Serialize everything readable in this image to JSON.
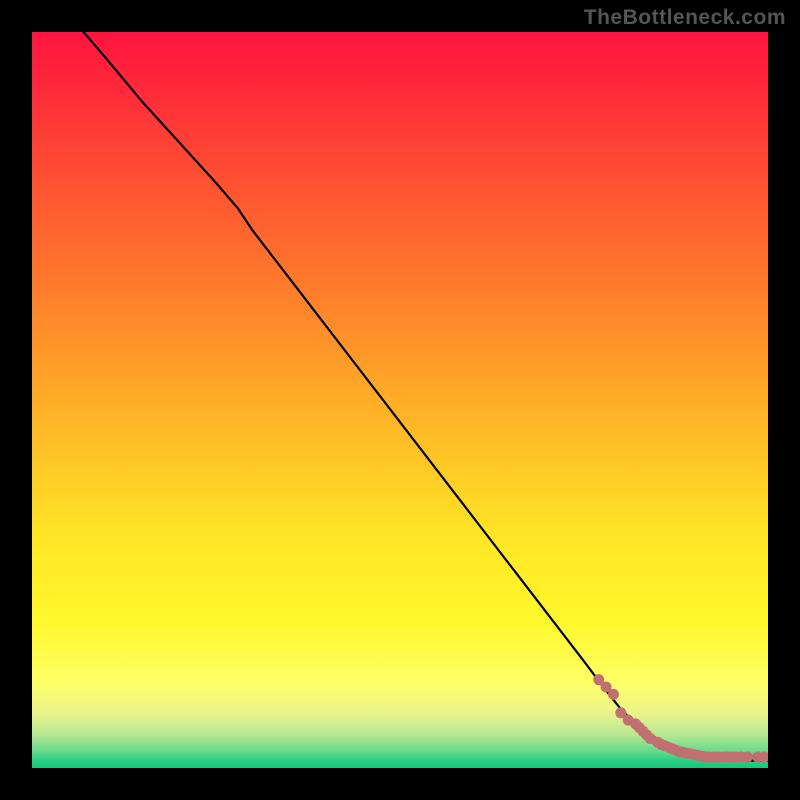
{
  "watermark": "TheBottleneck.com",
  "colors": {
    "background": "#000000",
    "gradient_stops": [
      {
        "offset": 0.0,
        "color": "#ff143f"
      },
      {
        "offset": 0.08,
        "color": "#ff2a3a"
      },
      {
        "offset": 0.18,
        "color": "#ff4a33"
      },
      {
        "offset": 0.3,
        "color": "#ff6d2e"
      },
      {
        "offset": 0.42,
        "color": "#ff9329"
      },
      {
        "offset": 0.55,
        "color": "#ffbc25"
      },
      {
        "offset": 0.68,
        "color": "#ffe425"
      },
      {
        "offset": 0.8,
        "color": "#fff82b"
      },
      {
        "offset": 0.885,
        "color": "#ffff66"
      },
      {
        "offset": 0.925,
        "color": "#eaf48a"
      },
      {
        "offset": 0.955,
        "color": "#b7e892"
      },
      {
        "offset": 0.975,
        "color": "#6fdb8e"
      },
      {
        "offset": 0.99,
        "color": "#2acf83"
      },
      {
        "offset": 1.0,
        "color": "#13c877"
      }
    ],
    "curve": "#000000",
    "points": "#c07070"
  },
  "chart_data": {
    "type": "line",
    "title": "",
    "xlabel": "",
    "ylabel": "",
    "xlim": [
      0,
      100
    ],
    "ylim": [
      0,
      100
    ],
    "legend": false,
    "grid": false,
    "series": [
      {
        "name": "curve",
        "style": "line",
        "x": [
          7,
          10,
          15,
          20,
          25,
          28,
          30,
          35,
          40,
          45,
          50,
          55,
          60,
          65,
          70,
          75,
          78,
          80,
          82,
          84,
          86,
          88,
          90,
          92,
          94,
          96,
          98,
          100
        ],
        "y": [
          100,
          96.5,
          90.5,
          85,
          79.5,
          76,
          73,
          66.5,
          60,
          53.5,
          47,
          40.5,
          34,
          27.5,
          21,
          14.5,
          10.5,
          8,
          6,
          4.5,
          3.4,
          2.6,
          2.0,
          1.6,
          1.3,
          1.1,
          1.0,
          1.0
        ]
      },
      {
        "name": "points",
        "style": "scatter",
        "x": [
          77,
          78,
          79,
          80,
          81,
          82,
          82.5,
          83,
          83.5,
          84,
          85,
          85.5,
          86,
          86.5,
          87,
          87.5,
          88,
          88.5,
          89,
          89.5,
          90,
          90.5,
          91,
          91.5,
          92,
          92.7,
          93.3,
          94,
          94.5,
          95,
          95.6,
          96.3,
          97.2,
          98.6,
          99.5
        ],
        "y": [
          12,
          11,
          10,
          7.5,
          6.5,
          6,
          5.5,
          5,
          4.5,
          4,
          3.5,
          3.2,
          3.0,
          2.8,
          2.6,
          2.4,
          2.2,
          2.1,
          2.0,
          1.9,
          1.8,
          1.7,
          1.6,
          1.5,
          1.5,
          1.5,
          1.5,
          1.5,
          1.5,
          1.5,
          1.5,
          1.5,
          1.5,
          1.5,
          1.5
        ]
      }
    ]
  }
}
